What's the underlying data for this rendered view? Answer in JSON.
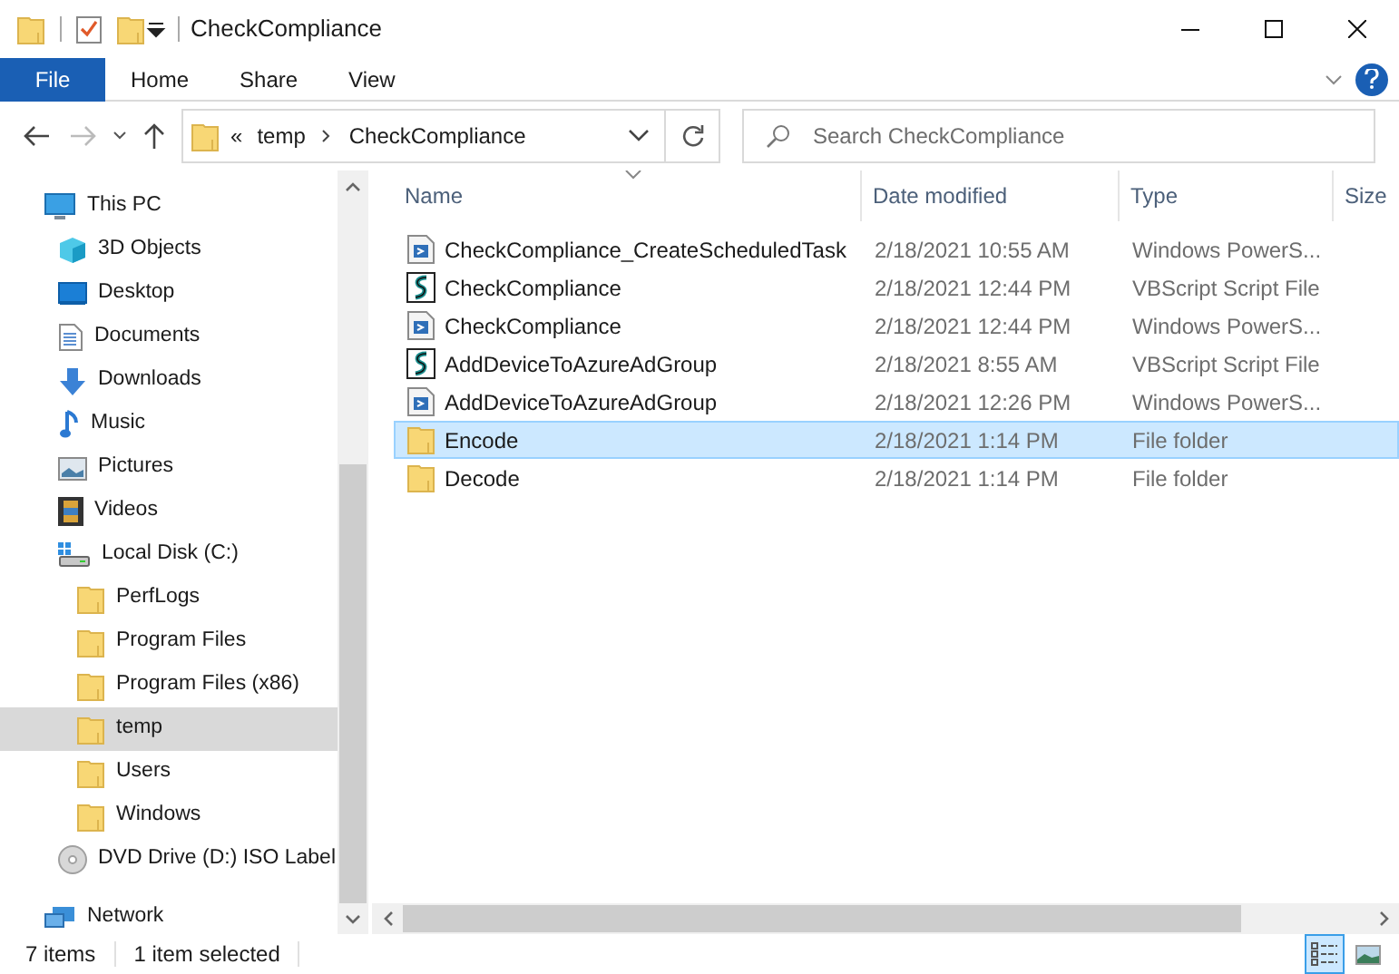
{
  "window": {
    "title": "CheckCompliance"
  },
  "ribbon_tabs": [
    {
      "label": "File",
      "kind": "file"
    },
    {
      "label": "Home",
      "kind": "tab"
    },
    {
      "label": "Share",
      "kind": "tab"
    },
    {
      "label": "View",
      "kind": "tab"
    }
  ],
  "address_bar": {
    "overflow": "«",
    "segments": [
      "temp",
      "CheckCompliance"
    ]
  },
  "search": {
    "placeholder": "Search CheckCompliance"
  },
  "sidebar": {
    "items": [
      {
        "label": "This PC",
        "kind": "pc",
        "selected": false,
        "children": [
          {
            "label": "3D Objects",
            "kind": "objects3d",
            "selected": false
          },
          {
            "label": "Desktop",
            "kind": "desktop",
            "selected": false
          },
          {
            "label": "Documents",
            "kind": "documents",
            "selected": false
          },
          {
            "label": "Downloads",
            "kind": "downloads",
            "selected": false
          },
          {
            "label": "Music",
            "kind": "music",
            "selected": false
          },
          {
            "label": "Pictures",
            "kind": "pictures",
            "selected": false
          },
          {
            "label": "Videos",
            "kind": "videos",
            "selected": false
          },
          {
            "label": "Local Disk (C:)",
            "kind": "disk",
            "selected": false,
            "children": [
              {
                "label": "PerfLogs",
                "kind": "folder",
                "selected": false
              },
              {
                "label": "Program Files",
                "kind": "folder",
                "selected": false
              },
              {
                "label": "Program Files (x86)",
                "kind": "folder",
                "selected": false
              },
              {
                "label": "temp",
                "kind": "folder",
                "selected": true
              },
              {
                "label": "Users",
                "kind": "folder",
                "selected": false
              },
              {
                "label": "Windows",
                "kind": "folder",
                "selected": false
              }
            ]
          },
          {
            "label": "DVD Drive (D:) ISO Label",
            "kind": "dvd",
            "selected": false
          }
        ]
      },
      {
        "label": "Network",
        "kind": "network",
        "selected": false
      }
    ]
  },
  "table": {
    "columns": [
      "Name",
      "Date modified",
      "Type",
      "Size"
    ],
    "rows": [
      {
        "name": "CheckCompliance_CreateScheduledTask",
        "date": "2/18/2021 10:55 AM",
        "type": "Windows PowerS...",
        "kind": "powershell",
        "selected": false
      },
      {
        "name": "CheckCompliance",
        "date": "2/18/2021 12:44 PM",
        "type": "VBScript Script File",
        "kind": "vbscript",
        "selected": false
      },
      {
        "name": "CheckCompliance",
        "date": "2/18/2021 12:44 PM",
        "type": "Windows PowerS...",
        "kind": "powershell",
        "selected": false
      },
      {
        "name": "AddDeviceToAzureAdGroup",
        "date": "2/18/2021 8:55 AM",
        "type": "VBScript Script File",
        "kind": "vbscript",
        "selected": false
      },
      {
        "name": "AddDeviceToAzureAdGroup",
        "date": "2/18/2021 12:26 PM",
        "type": "Windows PowerS...",
        "kind": "powershell",
        "selected": false
      },
      {
        "name": "Encode",
        "date": "2/18/2021 1:14 PM",
        "type": "File folder",
        "kind": "folder",
        "selected": true
      },
      {
        "name": "Decode",
        "date": "2/18/2021 1:14 PM",
        "type": "File folder",
        "kind": "folder",
        "selected": false
      }
    ]
  },
  "status_bar": {
    "item_count": "7 items",
    "selection": "1 item selected"
  }
}
